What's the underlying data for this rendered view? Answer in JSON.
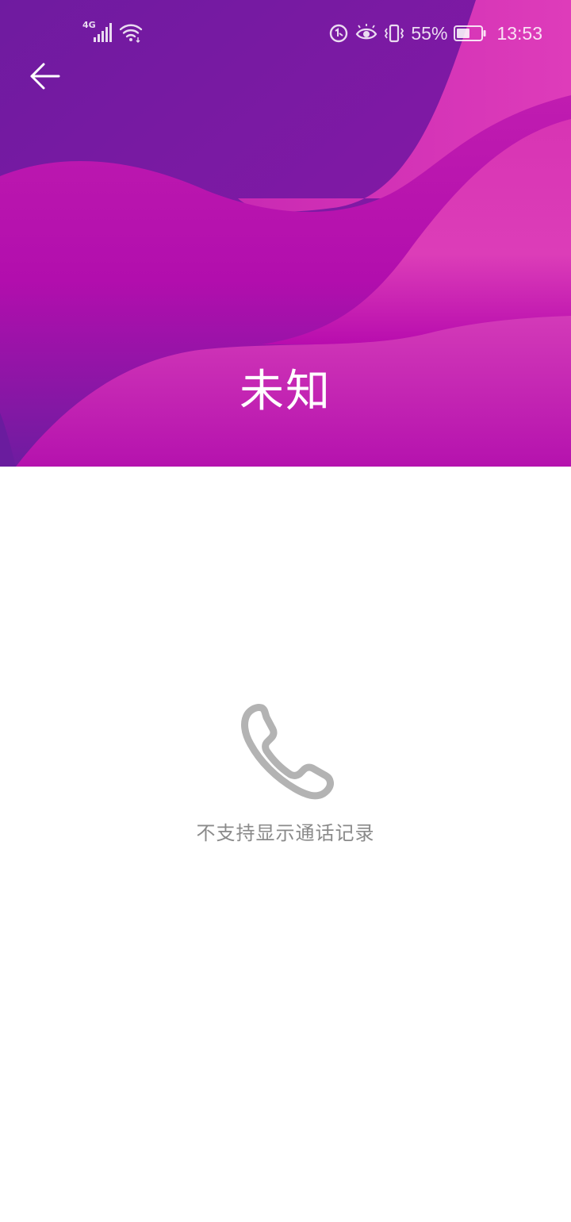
{
  "status_bar": {
    "network_type": "4G",
    "battery_percent": "55%",
    "time": "13:53",
    "icons": [
      "signal-icon",
      "wifi-icon",
      "data-saver-icon",
      "eye-comfort-icon",
      "vibrate-icon",
      "battery-icon"
    ],
    "battery_level": 0.55
  },
  "header": {
    "back_icon": "arrow-left-icon",
    "contact_name": "未知",
    "colors": {
      "deep_purple": "#6e1aa0",
      "magenta": "#b30fb0",
      "pink": "#db3cb8"
    }
  },
  "empty_state": {
    "icon": "phone-icon",
    "message": "不支持显示通话记录"
  }
}
